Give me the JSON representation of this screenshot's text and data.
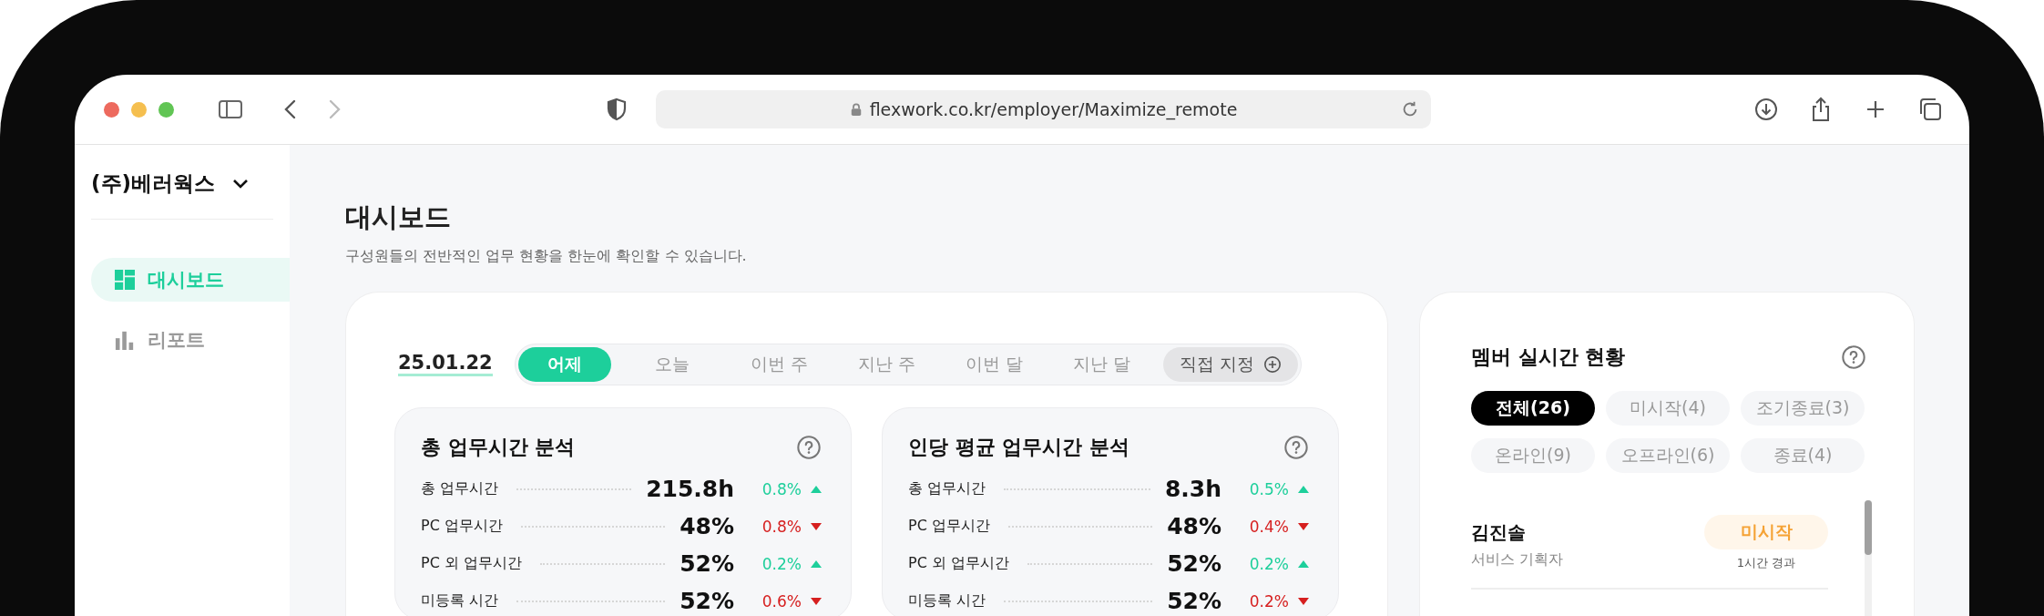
{
  "browser": {
    "url": "flexwork.co.kr/employer/Maximize_remote"
  },
  "sidebar": {
    "company": "(주)베러웍스",
    "items": [
      {
        "label": "대시보드",
        "kind": "dashboard",
        "selected": true
      },
      {
        "label": "리포트",
        "kind": "report",
        "selected": false
      }
    ]
  },
  "page": {
    "title": "대시보드",
    "subtitle": "구성원들의 전반적인 업무 현황을 한눈에 확인할 수 있습니다."
  },
  "date": "25.01.22",
  "periods": [
    {
      "label": "어제",
      "kind": "preset",
      "selected": true
    },
    {
      "label": "오늘",
      "kind": "preset",
      "selected": false
    },
    {
      "label": "이번 주",
      "kind": "preset",
      "selected": false
    },
    {
      "label": "지난 주",
      "kind": "preset",
      "selected": false
    },
    {
      "label": "이번 달",
      "kind": "preset",
      "selected": false
    },
    {
      "label": "지난 달",
      "kind": "preset",
      "selected": false
    },
    {
      "label": "직접 지정",
      "kind": "custom",
      "selected": false
    }
  ],
  "cards": [
    {
      "title": "총 업무시간 분석",
      "rows": [
        {
          "label": "총 업무시간",
          "value": "215.8h",
          "change": "0.8%",
          "rising": true
        },
        {
          "label": "PC 업무시간",
          "value": "48%",
          "change": "0.8%",
          "rising": false
        },
        {
          "label": "PC 외 업무시간",
          "value": "52%",
          "change": "0.2%",
          "rising": true
        },
        {
          "label": "미등록 시간",
          "value": "52%",
          "change": "0.6%",
          "rising": false
        }
      ]
    },
    {
      "title": "인당 평균 업무시간 분석",
      "rows": [
        {
          "label": "총 업무시간",
          "value": "8.3h",
          "change": "0.5%",
          "rising": true
        },
        {
          "label": "PC 업무시간",
          "value": "48%",
          "change": "0.4%",
          "rising": false
        },
        {
          "label": "PC 외 업무시간",
          "value": "52%",
          "change": "0.2%",
          "rising": true
        },
        {
          "label": "미등록 시간",
          "value": "52%",
          "change": "0.2%",
          "rising": false
        }
      ]
    }
  ],
  "members_panel": {
    "title": "멤버 실시간 현황",
    "filters": [
      {
        "label": "전체(26)",
        "selected": true
      },
      {
        "label": "미시작(4)",
        "selected": false
      },
      {
        "label": "조기종료(3)",
        "selected": false
      },
      {
        "label": "온라인(9)",
        "selected": false
      },
      {
        "label": "오프라인(6)",
        "selected": false
      },
      {
        "label": "종료(4)",
        "selected": false
      }
    ],
    "members": [
      {
        "name": "김진솔",
        "role": "서비스 기획자",
        "status": "미시작",
        "elapsed": "1시간 경과"
      }
    ]
  }
}
